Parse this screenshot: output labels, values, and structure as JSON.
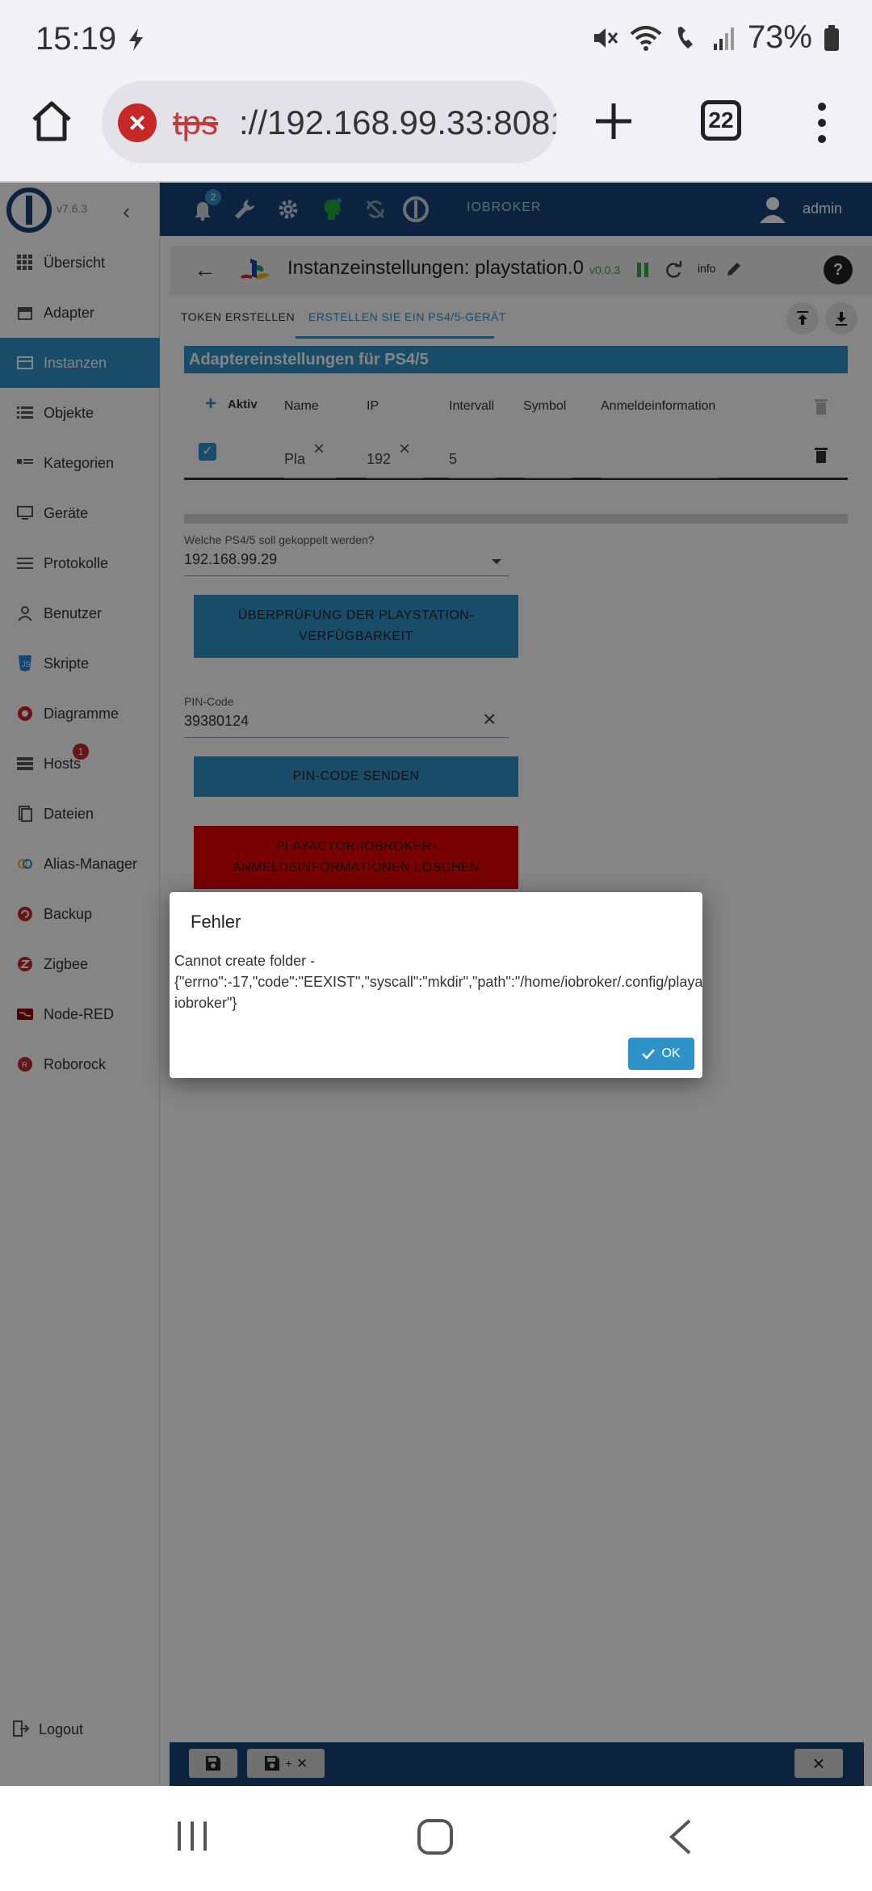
{
  "status_bar": {
    "time": "15:19",
    "battery": "73%"
  },
  "browser": {
    "url_scheme": "tps",
    "url_host": "://192.168.99.33:8081",
    "tab_count": "22"
  },
  "sidebar": {
    "version": "v7.6.3",
    "items": [
      {
        "label": "Übersicht"
      },
      {
        "label": "Adapter"
      },
      {
        "label": "Instanzen"
      },
      {
        "label": "Objekte"
      },
      {
        "label": "Kategorien"
      },
      {
        "label": "Geräte"
      },
      {
        "label": "Protokolle"
      },
      {
        "label": "Benutzer"
      },
      {
        "label": "Skripte"
      },
      {
        "label": "Diagramme"
      },
      {
        "label": "Hosts"
      },
      {
        "label": "Dateien"
      },
      {
        "label": "Alias-Manager"
      },
      {
        "label": "Backup"
      },
      {
        "label": "Zigbee"
      },
      {
        "label": "Node-RED"
      },
      {
        "label": "Roborock"
      }
    ],
    "hosts_badge": "1",
    "logout": "Logout"
  },
  "topbar": {
    "notifications_count": "2",
    "brand": "IOBROKER",
    "user": "admin"
  },
  "instance": {
    "title": "Instanzeinstellungen: playstation.0",
    "version": "v0.0.3",
    "info": "info"
  },
  "tabs": [
    {
      "label": "TOKEN ERSTELLEN"
    },
    {
      "label": "ERSTELLEN SIE EIN PS4/5-GERÄT"
    }
  ],
  "section_title": "Adaptereinstellungen für PS4/5",
  "table": {
    "add_label": "Aktiv",
    "headers": [
      "Name",
      "IP",
      "Intervall",
      "Symbol",
      "Anmeldeinformation"
    ],
    "row": {
      "name": "Pla",
      "ip": "192",
      "interval": "5",
      "symbol": "",
      "credentials": ""
    }
  },
  "ps_select": {
    "label": "Welche PS4/5 soll gekoppelt werden?",
    "value": "192.168.99.29"
  },
  "buttons": {
    "check": "ÜBERPRÜFUNG DER PLAYSTATION-VERFÜGBARKEIT",
    "send_pin": "PIN-CODE SENDEN",
    "delete_creds": "PLAYACTOR-IOBROKER-ANMELDEINFORMATIONEN LÖSCHEN"
  },
  "pin": {
    "label": "PIN-Code",
    "value": "39380124"
  },
  "dialog": {
    "title": "Fehler",
    "message": "Cannot create folder - {\"errno\":-17,\"code\":\"EEXIST\",\"syscall\":\"mkdir\",\"path\":\"/home/iobroker/.config/playactor-iobroker\"}",
    "ok": "OK"
  },
  "colors": {
    "accent": "#2f93c8",
    "topbar": "#164477",
    "danger": "#e60000"
  }
}
